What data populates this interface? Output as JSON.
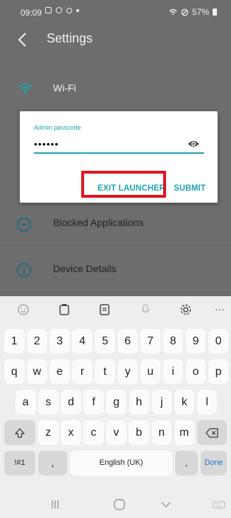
{
  "status": {
    "time": "09:09",
    "battery": "57%"
  },
  "header": {
    "title": "Settings"
  },
  "list": {
    "wifi": "Wi-Fi",
    "blocked": "Blocked Applications",
    "device": "Device Details"
  },
  "dialog": {
    "label": "Admin passcode",
    "value": "••••••",
    "exit_label": "EXIT LAUNCHER",
    "submit_label": "SUBMIT"
  },
  "keyboard": {
    "row1": [
      "1",
      "2",
      "3",
      "4",
      "5",
      "6",
      "7",
      "8",
      "9",
      "0"
    ],
    "row2": [
      "q",
      "w",
      "e",
      "r",
      "t",
      "y",
      "u",
      "i",
      "o",
      "p"
    ],
    "row3": [
      "a",
      "s",
      "d",
      "f",
      "g",
      "h",
      "j",
      "k",
      "l"
    ],
    "row4": [
      "z",
      "x",
      "c",
      "v",
      "b",
      "n",
      "m"
    ],
    "sym": "!#1",
    "comma": ",",
    "space": "English (UK)",
    "period": ".",
    "done": "Done"
  },
  "colors": {
    "accent": "#1aa3b0",
    "highlight": "#e0141e"
  }
}
